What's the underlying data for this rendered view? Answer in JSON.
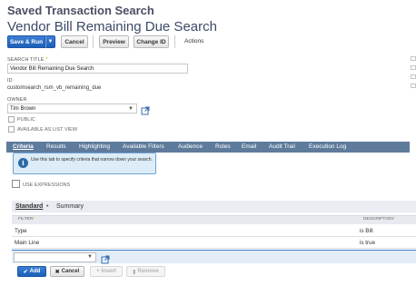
{
  "header": {
    "page_heading": "Saved Transaction Search",
    "record_title": "Vendor Bill Remaining Due Search"
  },
  "toolbar": {
    "save_run_label": "Save & Run",
    "cancel_label": "Cancel",
    "preview_label": "Preview",
    "change_id_label": "Change ID",
    "actions_label": "Actions"
  },
  "form": {
    "search_title_label": "SEARCH TITLE",
    "search_title_required": "*",
    "search_title_value": "Vendor Bill Remaining Due Search",
    "id_label": "ID",
    "id_value": "customsearch_rsm_vb_remaining_due",
    "owner_label": "OWNER",
    "owner_value": "Tim Brown",
    "public_label": "PUBLIC",
    "list_view_label": "AVAILABLE AS LIST VIEW"
  },
  "tabs": [
    {
      "label": "Criteria",
      "active": true
    },
    {
      "label": "Results"
    },
    {
      "label": "Highlighting"
    },
    {
      "label": "Available Filters"
    },
    {
      "label": "Audience"
    },
    {
      "label": "Roles"
    },
    {
      "label": "Email"
    },
    {
      "label": "Audit Trail"
    },
    {
      "label": "Execution Log"
    }
  ],
  "tooltip": {
    "text": "Use this tab to specify criteria that narrow down your search."
  },
  "criteria": {
    "use_expressions_label": "USE EXPRESSIONS",
    "subtabs": {
      "standard": "Standard",
      "standard_marker": "•",
      "summary": "Summary"
    },
    "columns": {
      "filter": "FILTER",
      "filter_required": "*",
      "description": "DESCRIPTION",
      "description_required": "*"
    },
    "rows": [
      {
        "filter": "Type",
        "description": "is Bill"
      },
      {
        "filter": "Main Line",
        "description": "is true"
      }
    ]
  },
  "row_actions": {
    "add_label": "Add",
    "cancel_label": "Cancel",
    "insert_label": "Insert",
    "remove_label": "Remove"
  },
  "colors": {
    "primary_button": "#1b5fb8",
    "tab_bar": "#5e7b9c",
    "tooltip_bg": "#dcecf8",
    "edit_row_bg": "#e2edf8"
  }
}
